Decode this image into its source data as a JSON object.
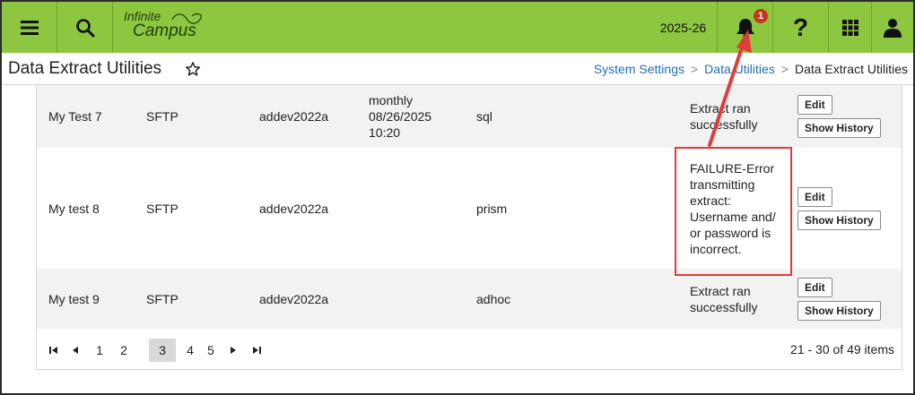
{
  "topbar": {
    "logo_line1": "Infinite",
    "logo_line2": "Campus",
    "year": "2025-26",
    "notification_count": "1",
    "help_glyph": "?",
    "accent_color": "#8dc63f"
  },
  "header": {
    "title": "Data Extract Utilities",
    "breadcrumbs": [
      "System Settings",
      "Data Utilities",
      "Data Extract Utilities"
    ],
    "breadcrumb_sep": ">"
  },
  "rows": [
    {
      "name": "My Test 7",
      "type": "SFTP",
      "user": "addev2022a",
      "schedule": "monthly 08/26/2025 10:20",
      "format": "sql",
      "status": "Extract ran successfully",
      "edit_label": "Edit",
      "history_label": "Show History"
    },
    {
      "name": "My test 8",
      "type": "SFTP",
      "user": "addev2022a",
      "schedule": "",
      "format": "prism",
      "status": "FAILURE-Error transmitting extract: Username and/ or password is incorrect.",
      "edit_label": "Edit",
      "history_label": "Show History"
    },
    {
      "name": "My test 9",
      "type": "SFTP",
      "user": "addev2022a",
      "schedule": "",
      "format": "adhoc",
      "status": "Extract ran successfully",
      "edit_label": "Edit",
      "history_label": "Show History"
    }
  ],
  "pager": {
    "pages": [
      "1",
      "2",
      "3",
      "4",
      "5"
    ],
    "current": "3",
    "info": "21 - 30 of 49 items"
  },
  "annotation_color": "#e23b3b"
}
